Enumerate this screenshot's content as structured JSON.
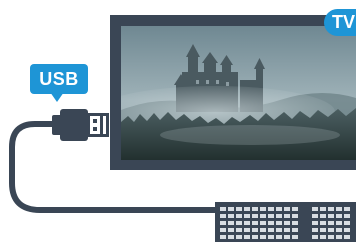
{
  "badges": {
    "usb_label": "USB",
    "tv_label": "TV"
  },
  "colors": {
    "accent": "#1e95d6",
    "dark": "#3a4655",
    "screen_fog": "#8fa3ab",
    "screen_forest": "#2d3c3e"
  },
  "icons": {
    "usb_plug": "usb-plug-icon",
    "keyboard": "keyboard-icon",
    "tv": "tv-icon"
  }
}
